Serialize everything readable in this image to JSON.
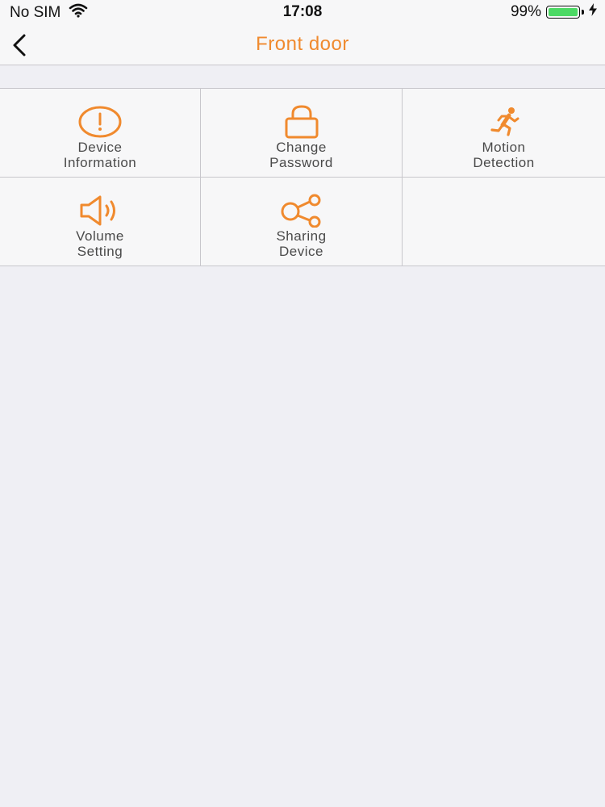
{
  "status_bar": {
    "carrier": "No SIM",
    "time": "17:08",
    "battery": "99%",
    "battery_level": 0.99,
    "battery_color": "#4cd964"
  },
  "nav": {
    "title": "Front door",
    "back_icon": "chevron-left-icon"
  },
  "accent_color": "#f08a2e",
  "menu": [
    {
      "line1": "Device",
      "line2": "Information",
      "icon": "alert-circle-icon"
    },
    {
      "line1": "Change",
      "line2": "Password",
      "icon": "lock-icon"
    },
    {
      "line1": "Motion",
      "line2": "Detection",
      "icon": "running-person-icon"
    },
    {
      "line1": "Volume",
      "line2": "Setting",
      "icon": "speaker-icon"
    },
    {
      "line1": "Sharing",
      "line2": "Device",
      "icon": "share-icon"
    }
  ]
}
